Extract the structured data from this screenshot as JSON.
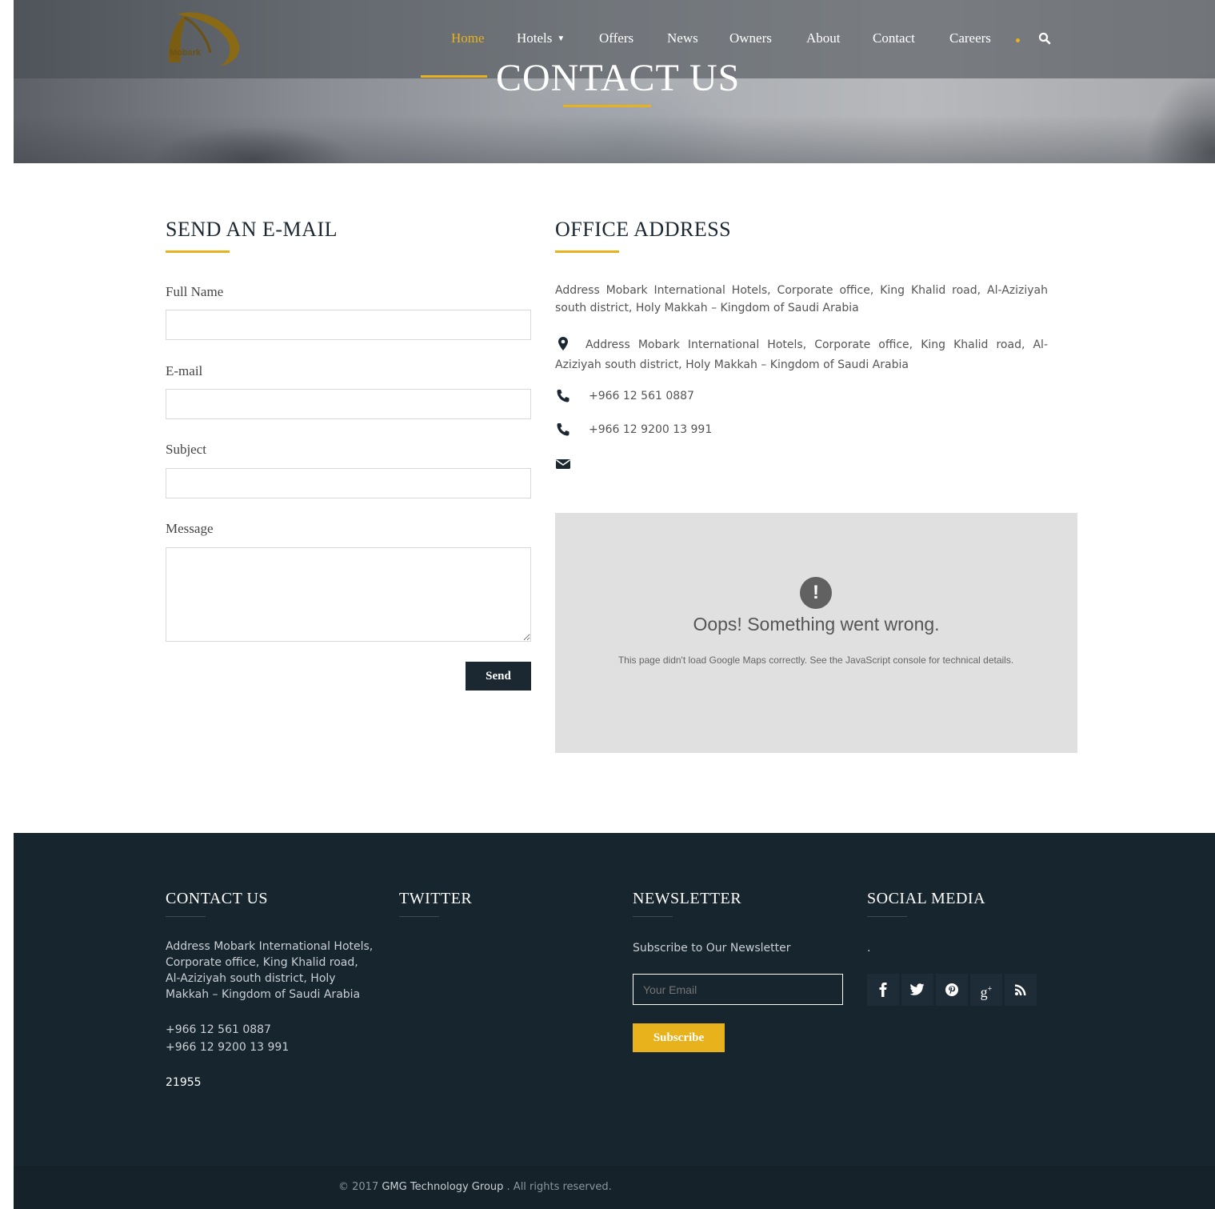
{
  "brand": {
    "logo_text": "Mobark"
  },
  "nav": {
    "items": [
      {
        "label": "Home",
        "active": true
      },
      {
        "label": "Hotels",
        "dropdown": true
      },
      {
        "label": "Offers"
      },
      {
        "label": "News"
      },
      {
        "label": "Owners"
      },
      {
        "label": "About"
      },
      {
        "label": "Contact"
      },
      {
        "label": "Careers"
      }
    ],
    "search_icon": "search-icon"
  },
  "hero": {
    "title": "CONTACT US"
  },
  "form": {
    "title": "SEND AN E-MAIL",
    "full_name_label": "Full Name",
    "email_label": "E-mail",
    "subject_label": "Subject",
    "message_label": "Message",
    "full_name_value": "",
    "email_value": "",
    "subject_value": "",
    "message_value": "",
    "send_label": "Send"
  },
  "office": {
    "title": "OFFICE ADDRESS",
    "address": "Address Mobark International Hotels, Corporate office, King Khalid road, Al-Aziziyah south district, Holy Makkah – Kingdom of Saudi Arabia",
    "address_with_icon": "Address Mobark International Hotels, Corporate office, King Khalid road, Al-Aziziyah south district, Holy Makkah – Kingdom of Saudi Arabia",
    "phone_1": "+966 12 561 0887",
    "phone_2": "+966 12 9200 13 991",
    "email": ""
  },
  "map_error": {
    "icon": "!",
    "title": "Oops! Something went wrong.",
    "description": "This page didn't load Google Maps correctly. See the JavaScript console for technical details."
  },
  "footer": {
    "contact": {
      "title": "CONTACT US",
      "address": "Address Mobark International Hotels, Corporate office, King Khalid road, Al-Aziziyah south district, Holy Makkah – Kingdom of Saudi Arabia",
      "phone_1": "+966 12 561 0887",
      "phone_2": "+966 12 9200 13 991",
      "zip": "21955"
    },
    "twitter": {
      "title": "TWITTER"
    },
    "newsletter": {
      "title": "NEWSLETTER",
      "text": "Subscribe to Our Newsletter",
      "placeholder": "Your Email",
      "button": "Subscribe"
    },
    "social": {
      "title": "SOCIAL MEDIA",
      "text": ".",
      "icons": [
        "facebook-icon",
        "twitter-icon",
        "pinterest-icon",
        "google-plus-icon",
        "rss-icon"
      ]
    },
    "copyright_prefix": "© 2017",
    "copyright_brand": "GMG Technology Group",
    "copyright_suffix": ". All rights reserved."
  },
  "colors": {
    "accent": "#e8b21d",
    "dark": "#1b2832",
    "footer_bg": "#17252e",
    "map_bg": "#e0e0e0"
  }
}
